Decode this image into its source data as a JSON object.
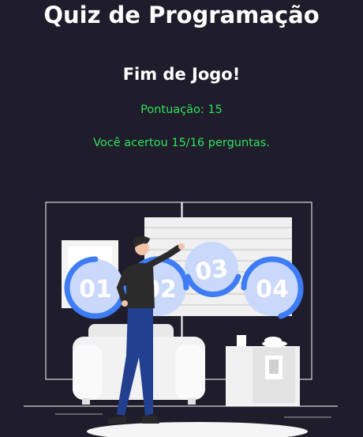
{
  "quiz": {
    "title": "Quiz de Programação",
    "game_over": "Fim de Jogo!",
    "score_text": "Pontuação: 15",
    "result_text": "Você acertou 15/16 perguntas."
  },
  "illustration": {
    "steps": [
      "01",
      "02",
      "03",
      "04"
    ]
  },
  "colors": {
    "background": "#1f1c2c",
    "accent_green": "#2ee35a",
    "step_blue": "#3d7cf4",
    "step_fill": "#c9d8fb"
  }
}
